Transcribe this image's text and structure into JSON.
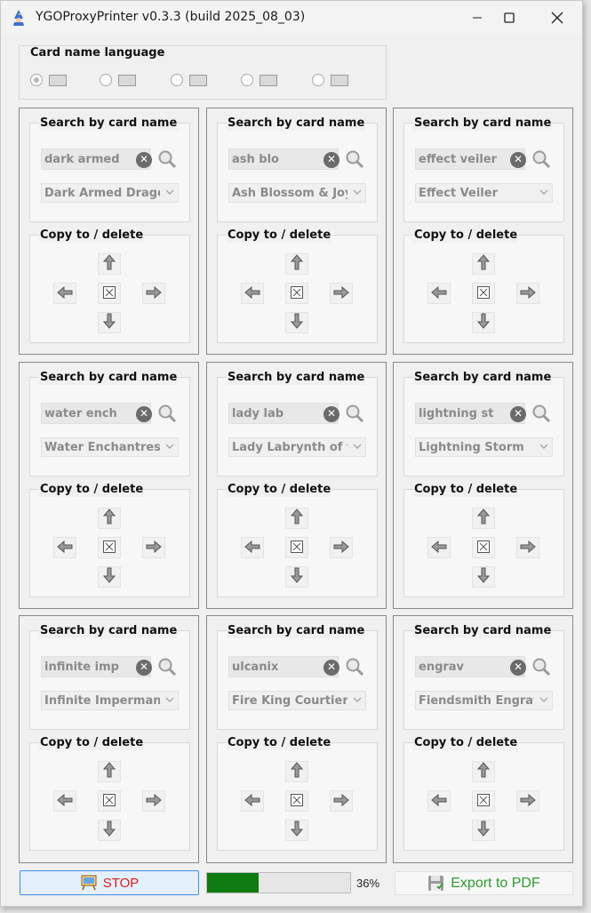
{
  "window": {
    "title": "YGOProxyPrinter v0.3.3 (build 2025_08_03)"
  },
  "language": {
    "label": "Card name language",
    "options": [
      {
        "flag": "flag-icon-1",
        "selected": true
      },
      {
        "flag": "flag-icon-2",
        "selected": false
      },
      {
        "flag": "flag-icon-3",
        "selected": false
      },
      {
        "flag": "flag-icon-4",
        "selected": false
      },
      {
        "flag": "flag-icon-5",
        "selected": false
      }
    ]
  },
  "cards": [
    {
      "search_label": "Search by card name",
      "query": "dark armed",
      "selected": "Dark Armed Dragon",
      "copy_label": "Copy to / delete"
    },
    {
      "search_label": "Search by card name",
      "query": "ash blo",
      "selected": "Ash Blossom & Joyo",
      "copy_label": "Copy to / delete"
    },
    {
      "search_label": "Search by card name",
      "query": "effect veiler",
      "selected": "Effect Veiler",
      "copy_label": "Copy to / delete"
    },
    {
      "search_label": "Search by card name",
      "query": "water ench",
      "selected": "Water Enchantress",
      "copy_label": "Copy to / delete"
    },
    {
      "search_label": "Search by card name",
      "query": "lady lab",
      "selected": "Lady Labrynth of th",
      "copy_label": "Copy to / delete"
    },
    {
      "search_label": "Search by card name",
      "query": "lightning st",
      "selected": "Lightning Storm",
      "copy_label": "Copy to / delete"
    },
    {
      "search_label": "Search by card name",
      "query": "infinite imp",
      "selected": "Infinite Impermaner",
      "copy_label": "Copy to / delete"
    },
    {
      "search_label": "Search by card name",
      "query": "ulcanix",
      "selected": "Fire King Courtier Ul",
      "copy_label": "Copy to / delete"
    },
    {
      "search_label": "Search by card name",
      "query": "engrav",
      "selected": "Fiendsmith Engraver",
      "copy_label": "Copy to / delete"
    }
  ],
  "footer": {
    "stop_label": "STOP",
    "progress_value": 0.36,
    "progress_text": "36%",
    "export_label": "Export to PDF",
    "colors": {
      "stop": "#e21a1a",
      "progress": "#0e7c12",
      "export": "#2f9a2f"
    }
  }
}
